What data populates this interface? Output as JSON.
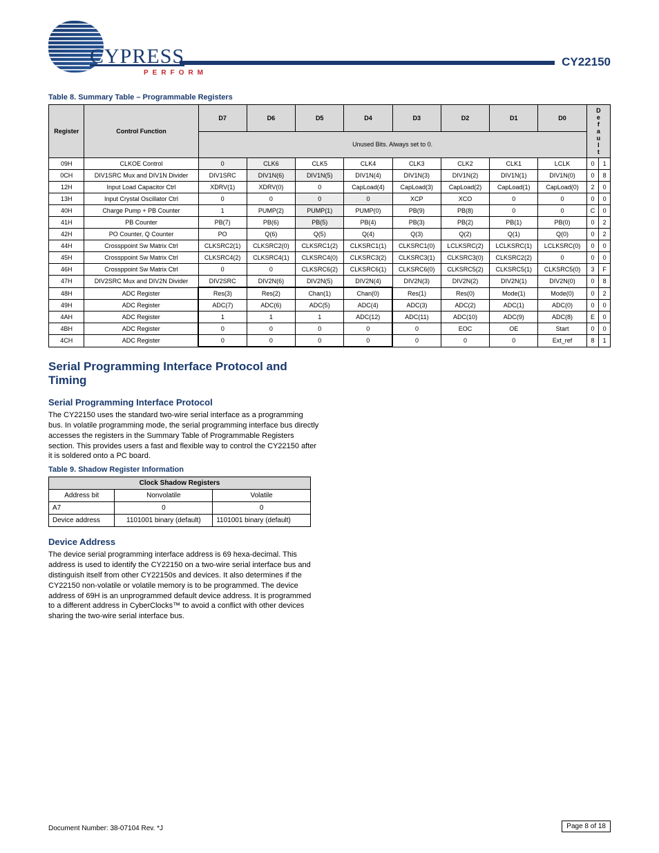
{
  "header": {
    "logo_main": "CYPRESS",
    "logo_sub": "PERFORM",
    "product": "CY22150"
  },
  "table8": {
    "caption": "Table 8.  Summary Table – Programmable Registers",
    "headers": [
      "Register",
      "Control Function",
      "D7",
      "D6",
      "D5",
      "D4",
      "D3",
      "D2",
      "D1",
      "D0"
    ],
    "note": "Unused Bits. Always set to 0.",
    "rows": [
      {
        "d": [
          "09H",
          "CLKOE Control",
          "0",
          "CLK6",
          "CLK5",
          "CLK4",
          "CLK3",
          "CLK2",
          "CLK1",
          "LCLK",
          "0",
          "1"
        ],
        "shade": [
          0,
          0,
          1,
          1,
          0,
          0,
          0,
          0,
          0,
          0
        ]
      },
      {
        "d": [
          "0CH",
          "DIV1SRC Mux and DIV1N Divider",
          "DIV1SRC",
          "DIV1N(6)",
          "DIV1N(5)",
          "DIV1N(4)",
          "DIV1N(3)",
          "DIV1N(2)",
          "DIV1N(1)",
          "DIV1N(0)",
          "0",
          "8"
        ],
        "shade": [
          0,
          0,
          0,
          1,
          1,
          0,
          0,
          0,
          0,
          0
        ]
      },
      {
        "d": [
          "12H",
          "Input Load Capacitor Ctrl",
          "XDRV(1)",
          "XDRV(0)",
          "0",
          "CapLoad(4)",
          "CapLoad(3)",
          "CapLoad(2)",
          "CapLoad(1)",
          "CapLoad(0)",
          "2",
          "0"
        ],
        "shade": [
          0,
          0,
          0,
          0,
          0,
          0,
          0,
          0,
          0,
          0
        ]
      },
      {
        "d": [
          "13H",
          "Input Crystal Oscillator Ctrl",
          "0",
          "0",
          "0",
          "0",
          "XCP",
          "XCO",
          "0",
          "0",
          "0",
          "0"
        ],
        "shade": [
          0,
          0,
          0,
          0,
          1,
          1,
          0,
          0,
          0,
          0
        ]
      },
      {
        "d": [
          "40H",
          "Charge Pump + PB Counter",
          "1",
          "PUMP(2)",
          "PUMP(1)",
          "PUMP(0)",
          "PB(9)",
          "PB(8)",
          "0",
          "0",
          "C",
          "0"
        ],
        "shade": [
          0,
          0,
          0,
          0,
          1,
          0,
          0,
          0,
          0,
          0
        ]
      },
      {
        "d": [
          "41H",
          "PB Counter",
          "PB(7)",
          "PB(6)",
          "PB(5)",
          "PB(4)",
          "PB(3)",
          "PB(2)",
          "PB(1)",
          "PB(0)",
          "0",
          "2"
        ],
        "shade": [
          0,
          0,
          0,
          0,
          1,
          0,
          0,
          0,
          0,
          0
        ]
      },
      {
        "d": [
          "42H",
          "PO Counter, Q Counter",
          "PO",
          "Q(6)",
          "Q(5)",
          "Q(4)",
          "Q(3)",
          "Q(2)",
          "Q(1)",
          "Q(0)",
          "0",
          "2"
        ],
        "shade": [
          0,
          0,
          0,
          0,
          0,
          0,
          0,
          0,
          0,
          0
        ]
      },
      {
        "d": [
          "44H",
          "Crossppoint Sw Matrix Ctrl",
          "CLKSRC2(1)",
          "CLKSRC2(0)",
          "CLKSRC1(2)",
          "CLKSRC1(1)",
          "CLKSRC1(0)",
          "LCLKSRC(2)",
          "LCLKSRC(1)",
          "LCLKSRC(0)",
          "0",
          "0"
        ],
        "shade": [
          0,
          0,
          0,
          0,
          0,
          0,
          0,
          0,
          0,
          0
        ]
      },
      {
        "d": [
          "45H",
          "Crossppoint Sw Matrix Ctrl",
          "CLKSRC4(2)",
          "CLKSRC4(1)",
          "CLKSRC4(0)",
          "CLKSRC3(2)",
          "CLKSRC3(1)",
          "CLKSRC3(0)",
          "CLKSRC2(2)",
          "0",
          "0",
          "0"
        ],
        "shade": [
          0,
          0,
          0,
          0,
          0,
          0,
          0,
          0,
          0,
          0
        ]
      },
      {
        "d": [
          "46H",
          "Crossppoint Sw Matrix Ctrl",
          "0",
          "0",
          "CLKSRC6(2)",
          "CLKSRC6(1)",
          "CLKSRC6(0)",
          "CLKSRC5(2)",
          "CLKSRC5(1)",
          "CLKSRC5(0)",
          "3",
          "F"
        ],
        "shade": [
          0,
          0,
          0,
          0,
          0,
          0,
          0,
          0,
          0,
          0
        ]
      },
      {
        "d": [
          "47H",
          "DIV2SRC Mux and DIV2N Divider",
          "DIV2SRC",
          "DIV2N(6)",
          "DIV2N(5)",
          "DIV2N(4)",
          "DIV2N(3)",
          "DIV2N(2)",
          "DIV2N(1)",
          "DIV2N(0)",
          "0",
          "8"
        ],
        "shade": [
          0,
          0,
          0,
          0,
          0,
          0,
          0,
          0,
          0,
          0
        ]
      }
    ],
    "adc_rows": [
      {
        "d": [
          "48H",
          "ADC Register",
          "Res(3)",
          "Res(2)",
          "Chan(1)",
          "Chan(0)",
          "Res(1)",
          "Res(0)",
          "Mode(1)",
          "Mode(0)",
          "0",
          "2"
        ]
      },
      {
        "d": [
          "49H",
          "ADC Register",
          "ADC(7)",
          "ADC(6)",
          "ADC(5)",
          "ADC(4)",
          "ADC(3)",
          "ADC(2)",
          "ADC(1)",
          "ADC(0)",
          "0",
          "0"
        ]
      },
      {
        "d": [
          "4AH",
          "ADC Register",
          "1",
          "1",
          "1",
          "ADC(12)",
          "ADC(11)",
          "ADC(10)",
          "ADC(9)",
          "ADC(8)",
          "E",
          "0"
        ]
      },
      {
        "d": [
          "4BH",
          "ADC Register",
          "0",
          "0",
          "0",
          "0",
          "0",
          "EOC",
          "OE",
          "Start",
          "0",
          "0"
        ]
      },
      {
        "d": [
          "4CH",
          "ADC Register",
          "0",
          "0",
          "0",
          "0",
          "0",
          "0",
          "0",
          "Ext_ref",
          "8",
          "1"
        ]
      }
    ]
  },
  "serial": {
    "h2": "Serial Programming Interface Protocol and Timing",
    "h3": "Serial Programming Interface Protocol",
    "p1": "The CY22150 uses the standard two-wire serial interface as a programming bus. In volatile programming mode, the serial programming interface bus directly accesses the registers in the Summary Table of Programmable Registers section. This provides users a fast and flexible way to control the CY22150 after it is soldered onto a PC board.",
    "table9caption": "Table 9.  Shadow Register Information",
    "table9": {
      "header": "Clock Shadow Registers",
      "rows": [
        [
          "Address bit",
          "Nonvolatile",
          "Volatile"
        ],
        [
          "A7",
          "0",
          "0"
        ],
        [
          "Device address",
          "1101001 binary (default)",
          "1101001 binary (default)"
        ]
      ]
    }
  },
  "devaddr": {
    "h3": "Device Address",
    "p1": "The device serial programming interface address is 69 hexa-decimal. This address is used to identify the CY22150 on a two-wire serial interface bus and distinguish itself from other CY22150s and devices. It also determines if the CY22150 non-volatile or volatile memory is to be programmed. The device address of 69H is an unprogrammed default device address. It is programmed to a different address in CyberClocks™ to avoid a conflict with other devices sharing the two-wire serial interface bus."
  },
  "footer": {
    "docnum": "Document Number: 38-07104 Rev. *J",
    "page": "Page 8 of 18"
  }
}
